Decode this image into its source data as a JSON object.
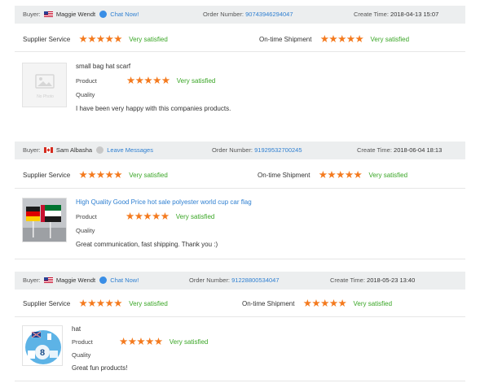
{
  "reviews": [
    {
      "buyer_label": "Buyer:",
      "buyer_name": "Maggie Wendt",
      "contact_label": "Chat Now!",
      "order_label": "Order Number:",
      "order_number": "90743946294047",
      "time_label": "Create Time:",
      "create_time": "2018-04-13 15:07",
      "supplier_label": "Supplier Service",
      "supplier_rating": "Very satisfied",
      "shipment_label": "On-time Shipment",
      "shipment_rating": "Very satisfied",
      "product_title": "small bag hat scarf",
      "product_label": "Product",
      "product_rating": "Very satisfied",
      "quality_label": "Quality",
      "comment": "I have been very happy with this companies products.",
      "thumb_placeholder": "No Photo",
      "flag_icon": "us-flag-icon",
      "stars": 5
    },
    {
      "buyer_label": "Buyer:",
      "buyer_name": "Sam Albasha",
      "contact_label": "Leave Messages",
      "order_label": "Order Number:",
      "order_number": "91929532700245",
      "time_label": "Create Time:",
      "create_time": "2018-06-04 18:13",
      "supplier_label": "Supplier Service",
      "supplier_rating": "Very satisfied",
      "shipment_label": "On-time Shipment",
      "shipment_rating": "Very satisfied",
      "product_title": "High Quality Good Price hot sale polyester world cup car flag",
      "product_label": "Product",
      "product_rating": "Very satisfied",
      "quality_label": "Quality",
      "comment": "Great communication, fast shipping. Thank you :)",
      "flag_icon": "canada-flag-icon",
      "stars": 5
    },
    {
      "buyer_label": "Buyer:",
      "buyer_name": "Maggie Wendt",
      "contact_label": "Chat Now!",
      "order_label": "Order Number:",
      "order_number": "91228800534047",
      "time_label": "Create Time:",
      "create_time": "2018-05-23 13:40",
      "supplier_label": "Supplier Service",
      "supplier_rating": "Very satisfied",
      "shipment_label": "On-time Shipment",
      "shipment_rating": "Very satisfied",
      "product_title": "hat",
      "product_label": "Product",
      "product_rating": "Very satisfied",
      "quality_label": "Quality",
      "comment": "Great fun products!",
      "flag_icon": "us-flag-icon",
      "stars": 5
    }
  ],
  "colors": {
    "star": "#f47a1e",
    "satisfied": "#3aa626",
    "link": "#2e7fd1",
    "header_bg": "#eceeef"
  },
  "star_glyph": "★★★★★"
}
